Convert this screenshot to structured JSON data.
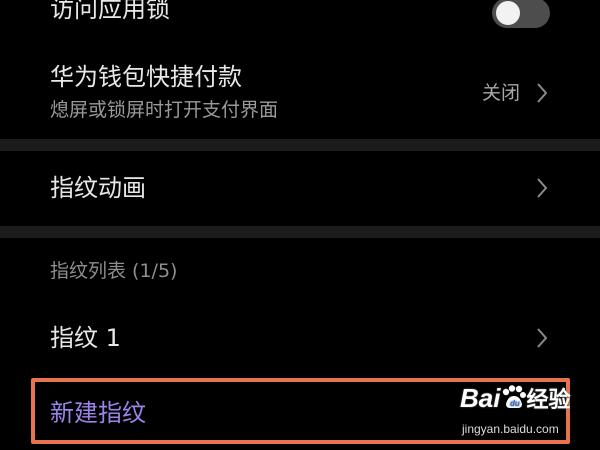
{
  "settings": {
    "app_lock": {
      "label": "访问应用锁",
      "toggle_state": "off"
    },
    "wallet_quickpay": {
      "label": "华为钱包快捷付款",
      "subtitle": "熄屏或锁屏时打开支付界面",
      "value": "关闭"
    },
    "fingerprint_animation": {
      "label": "指纹动画"
    },
    "fingerprint_list": {
      "header": "指纹列表 (1/5)",
      "items": [
        {
          "label": "指纹 1"
        }
      ],
      "new_label": "新建指纹"
    }
  },
  "watermark": {
    "logo_text": "Bai",
    "logo_tail": "经验",
    "url": "jingyan.baidu.com"
  },
  "colors": {
    "background": "#000000",
    "divider": "#1c1c1c",
    "primary_text": "#e8e8e8",
    "secondary_text": "#9a9a9a",
    "accent": "#9b83e8",
    "highlight_frame": "#e8734f"
  }
}
